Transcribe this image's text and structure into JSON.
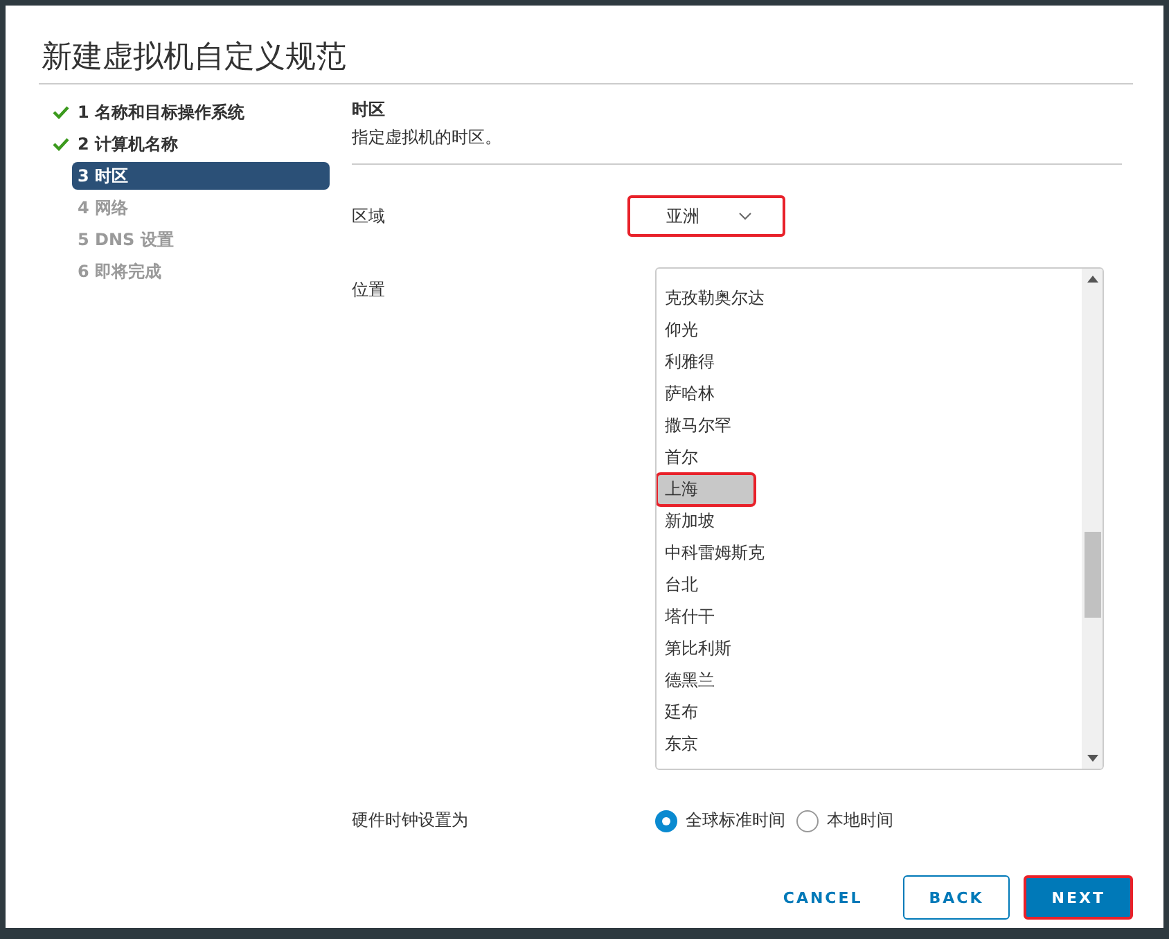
{
  "title": "新建虚拟机自定义规范",
  "steps": [
    {
      "label": "1 名称和目标操作系统",
      "done": true,
      "selected": false,
      "disabled": false
    },
    {
      "label": "2 计算机名称",
      "done": true,
      "selected": false,
      "disabled": false
    },
    {
      "label": "3 时区",
      "done": false,
      "selected": true,
      "disabled": false
    },
    {
      "label": "4 网络",
      "done": false,
      "selected": false,
      "disabled": true
    },
    {
      "label": "5 DNS 设置",
      "done": false,
      "selected": false,
      "disabled": true
    },
    {
      "label": "6 即将完成",
      "done": false,
      "selected": false,
      "disabled": true
    }
  ],
  "section": {
    "title": "时区",
    "description": "指定虚拟机的时区。"
  },
  "region": {
    "label": "区域",
    "value": "亚洲",
    "highlighted": true
  },
  "location": {
    "label": "位置",
    "items": [
      {
        "label": "克孜勒奥尔达",
        "selected": false,
        "highlighted": false
      },
      {
        "label": "仰光",
        "selected": false,
        "highlighted": false
      },
      {
        "label": "利雅得",
        "selected": false,
        "highlighted": false
      },
      {
        "label": "萨哈林",
        "selected": false,
        "highlighted": false
      },
      {
        "label": "撒马尔罕",
        "selected": false,
        "highlighted": false
      },
      {
        "label": "首尔",
        "selected": false,
        "highlighted": false
      },
      {
        "label": "上海",
        "selected": true,
        "highlighted": true
      },
      {
        "label": "新加坡",
        "selected": false,
        "highlighted": false
      },
      {
        "label": "中科雷姆斯克",
        "selected": false,
        "highlighted": false
      },
      {
        "label": "台北",
        "selected": false,
        "highlighted": false
      },
      {
        "label": "塔什干",
        "selected": false,
        "highlighted": false
      },
      {
        "label": "第比利斯",
        "selected": false,
        "highlighted": false
      },
      {
        "label": "德黑兰",
        "selected": false,
        "highlighted": false
      },
      {
        "label": "廷布",
        "selected": false,
        "highlighted": false
      },
      {
        "label": "东京",
        "selected": false,
        "highlighted": false
      }
    ]
  },
  "clock": {
    "label": "硬件时钟设置为",
    "options": [
      {
        "label": "全球标准时间",
        "selected": true
      },
      {
        "label": "本地时间",
        "selected": false
      }
    ]
  },
  "buttons": [
    {
      "label": "CANCEL",
      "kind": "flat",
      "highlighted": false
    },
    {
      "label": "BACK",
      "kind": "outline",
      "highlighted": false
    },
    {
      "label": "NEXT",
      "kind": "primary",
      "highlighted": true
    }
  ]
}
